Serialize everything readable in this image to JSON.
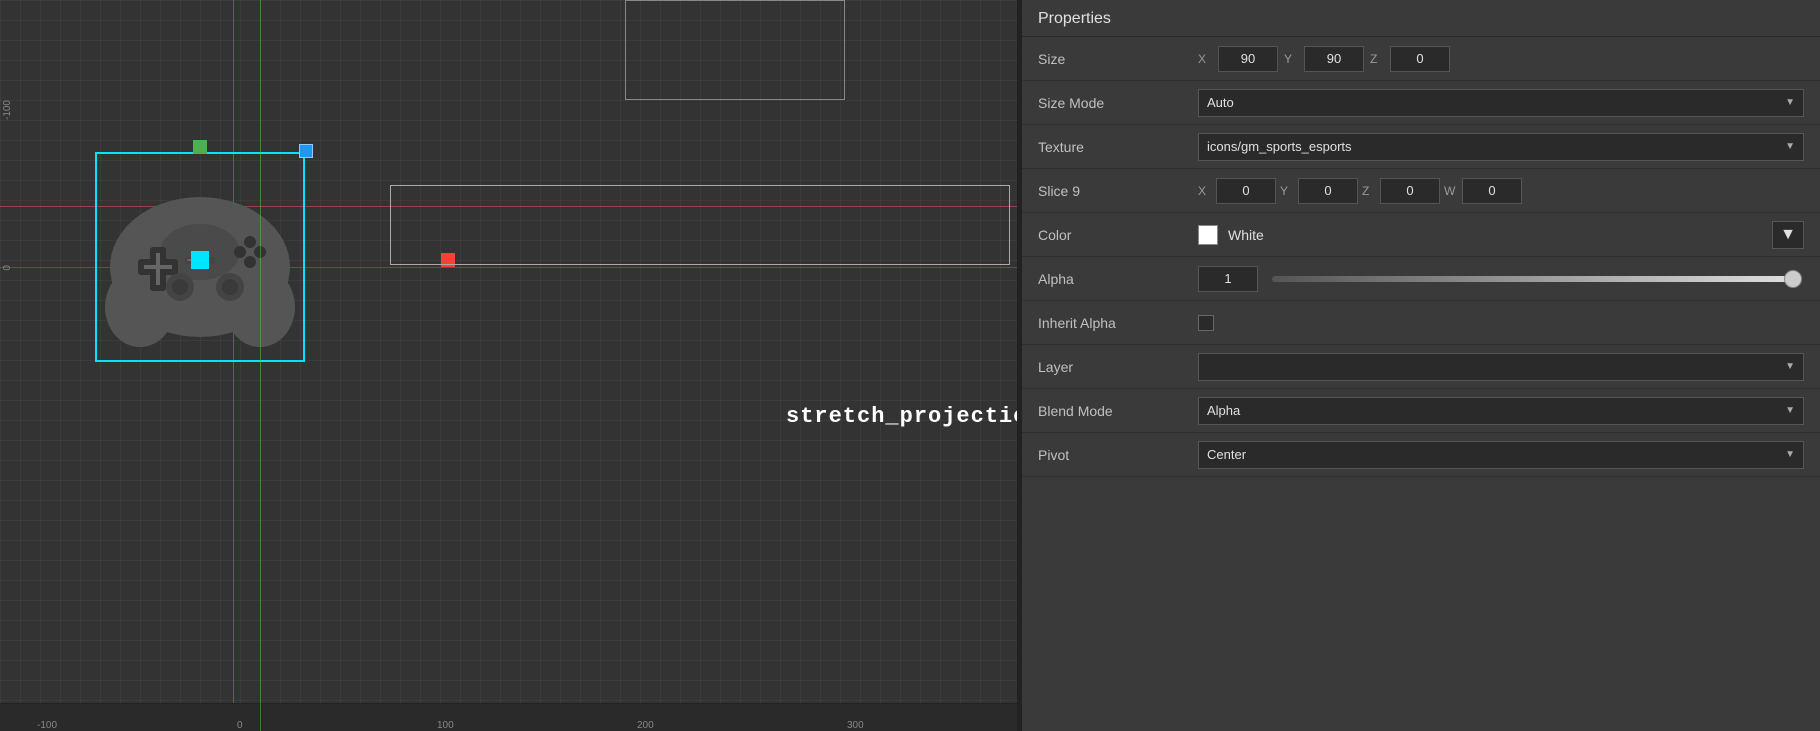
{
  "panel": {
    "title": "Properties",
    "sections": {
      "size": {
        "label": "Size",
        "x_label": "X",
        "x_value": "90",
        "y_label": "Y",
        "y_value": "90",
        "z_label": "Z",
        "z_value": "0"
      },
      "size_mode": {
        "label": "Size Mode",
        "value": "Auto"
      },
      "texture": {
        "label": "Texture",
        "value": "icons/gm_sports_esports"
      },
      "slice9": {
        "label": "Slice 9",
        "x_label": "X",
        "x_value": "0",
        "y_label": "Y",
        "y_value": "0",
        "z_label": "Z",
        "z_value": "0",
        "w_label": "W",
        "w_value": "0"
      },
      "color": {
        "label": "Color",
        "value": "White",
        "swatch_color": "#ffffff"
      },
      "alpha": {
        "label": "Alpha",
        "value": "1"
      },
      "inherit_alpha": {
        "label": "Inherit Alpha"
      },
      "layer": {
        "label": "Layer",
        "value": ""
      },
      "blend_mode": {
        "label": "Blend Mode",
        "value": "Alpha"
      },
      "pivot": {
        "label": "Pivot",
        "value": "Center"
      }
    }
  },
  "canvas": {
    "stretch_label": "stretch_projection",
    "ruler_ticks": [
      "-100",
      "0",
      "100",
      "200",
      "300"
    ],
    "ruler_positions": [
      "35",
      "235",
      "435",
      "635",
      "845"
    ]
  }
}
